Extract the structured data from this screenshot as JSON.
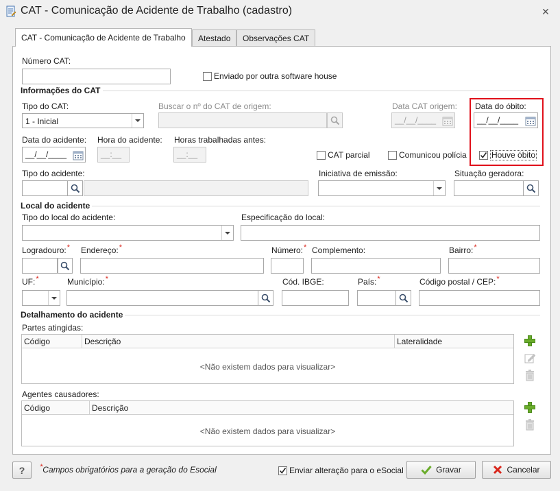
{
  "window": {
    "title": "CAT - Comunicação de Acidente de Trabalho (cadastro)",
    "close_glyph": "✕"
  },
  "tabs": [
    {
      "label": "CAT - Comunicação de Acidente de Trabalho",
      "active": true
    },
    {
      "label": "Atestado",
      "active": false
    },
    {
      "label": "Observações CAT",
      "active": false
    }
  ],
  "form": {
    "numero_cat_label": "Número CAT:",
    "numero_cat_value": "",
    "enviado_software_house_label": "Enviado por outra software house",
    "enviado_software_house_checked": false,
    "info_section": "Informações do CAT",
    "tipo_cat_label": "Tipo do CAT:",
    "tipo_cat_value": "1 - Inicial",
    "buscar_origem_label": "Buscar o nº do CAT de origem:",
    "data_cat_origem_label": "Data CAT origem:",
    "data_cat_origem_value": "__/__/____",
    "data_obito_label": "Data do óbito:",
    "data_obito_value": "__/__/____",
    "data_acidente_label": "Data do acidente:",
    "data_acidente_value": "__/__/____",
    "hora_acidente_label": "Hora do acidente:",
    "hora_acidente_value": "__:__",
    "horas_trabalhadas_label": "Horas trabalhadas antes:",
    "horas_trabalhadas_value": "__:__",
    "cat_parcial_label": "CAT parcial",
    "cat_parcial_checked": false,
    "comunicou_policia_label": "Comunicou polícia",
    "comunicou_policia_checked": false,
    "houve_obito_label": "Houve óbito",
    "houve_obito_checked": true,
    "tipo_acidente_label": "Tipo do acidente:",
    "iniciativa_emissao_label": "Iniciativa de emissão:",
    "situacao_geradora_label": "Situação geradora:",
    "local_section": "Local do acidente",
    "tipo_local_label": "Tipo do local do acidente:",
    "especificacao_local_label": "Especificação do local:",
    "logradouro_label": "Logradouro:",
    "endereco_label": "Endereço:",
    "numero_label": "Número:",
    "complemento_label": "Complemento:",
    "bairro_label": "Bairro:",
    "uf_label": "UF:",
    "municipio_label": "Município:",
    "cod_ibge_label": "Cód. IBGE:",
    "pais_label": "País:",
    "codigo_postal_label": "Código postal / CEP:",
    "required_mark": "*",
    "detalhamento_section": "Detalhamento do acidente",
    "partes_atingidas_label": "Partes atingidas:",
    "partes_columns": [
      "Código",
      "Descrição",
      "Lateralidade"
    ],
    "partes_empty": "<Não existem dados para visualizar>",
    "agentes_causadores_label": "Agentes causadores:",
    "agentes_columns": [
      "Código",
      "Descrição"
    ],
    "agentes_empty": "<Não existem dados para visualizar>"
  },
  "footer": {
    "help_label": "?",
    "required_note_mark": "*",
    "required_note": "Campos obrigatórios para a geração do Esocial",
    "enviar_esocial_label": "Enviar alteração para o eSocial",
    "enviar_esocial_checked": true,
    "gravar_label": "Gravar",
    "cancelar_label": "Cancelar"
  },
  "colors": {
    "highlight": "#e0101a",
    "required": "#d9261c",
    "add_green": "#6aac2b"
  }
}
